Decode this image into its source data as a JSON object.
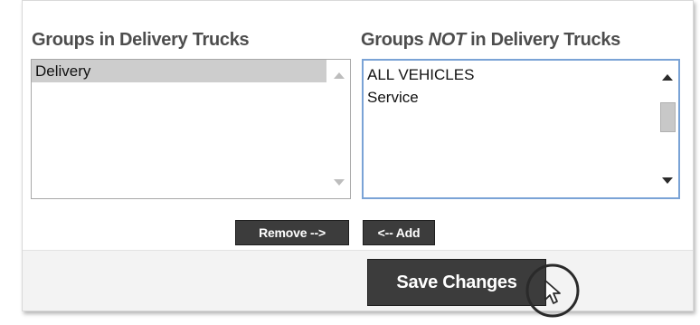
{
  "groups_in": {
    "title": "Groups in Delivery Trucks",
    "items": [
      "Delivery"
    ],
    "selected_index": 0
  },
  "groups_not_in": {
    "title_prefix": "Groups ",
    "title_emphasis": "NOT",
    "title_suffix": " in Delivery Trucks",
    "items": [
      "ALL VEHICLES",
      "Service"
    ]
  },
  "buttons": {
    "remove_label": "Remove -->",
    "add_label": "<-- Add",
    "save_label": "Save Changes"
  },
  "colors": {
    "button_bg": "#3c3c3c",
    "button_text": "#ffffff",
    "focus_border": "#7aa3d6",
    "selected_item_bg": "#cdcdcd",
    "footer_bg": "#f3f3f3"
  },
  "icons": {
    "cursor": "hand-pointer-cursor-icon"
  }
}
